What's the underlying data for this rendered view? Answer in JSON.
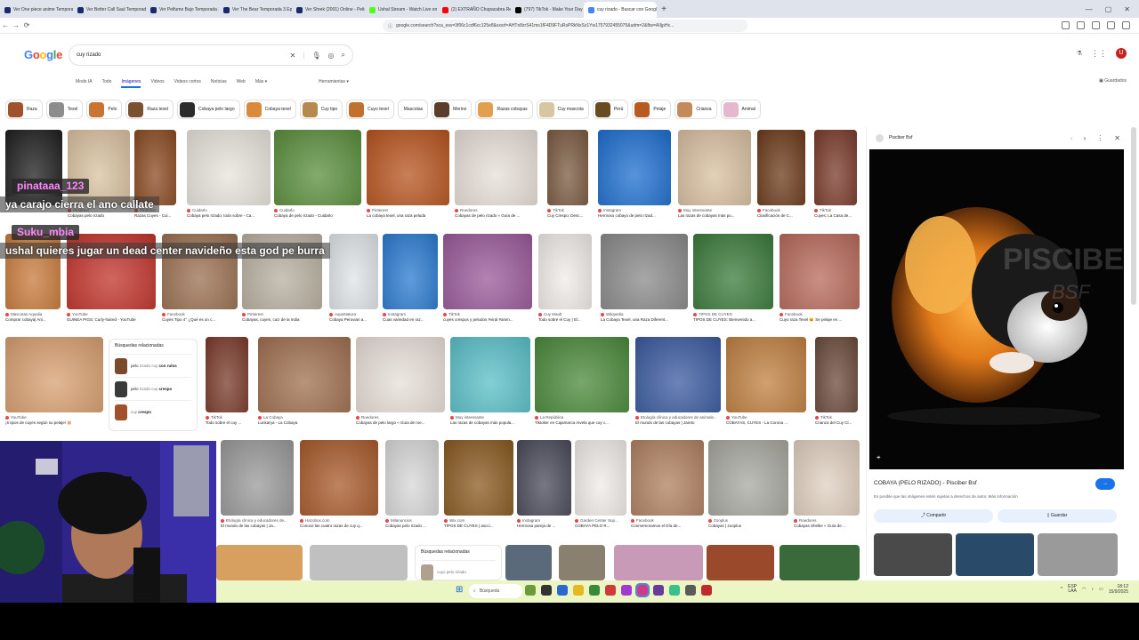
{
  "browser": {
    "tabs": [
      {
        "label": "Ver One piece anime Temporada 3 Episo",
        "color": "#1a2a6c"
      },
      {
        "label": "Ver Better Call Saul Temporada 2 Epi",
        "color": "#1a2a6c"
      },
      {
        "label": "Ver Pelfume Bajo Temporada 2 Episo",
        "color": "#1a2a6c"
      },
      {
        "label": "Ver The Bear Temporada 3 Episodio",
        "color": "#1a2a6c"
      },
      {
        "label": "Ver Shrek (2001) Online - PelisPlus",
        "color": "#1a2a6c"
      },
      {
        "label": "Ushal Stream - Watch Live on Kick",
        "color": "#53fc18"
      },
      {
        "label": "(2) EXTRAÑO Chupacabra Real En Mi C",
        "color": "#ff0000"
      },
      {
        "label": "(797) TikTok - Make Your Day",
        "color": "#000000"
      },
      {
        "label": "cuy rizado - Buscar con Google",
        "color": "#4285f4",
        "active": true
      }
    ],
    "new_tab": "+",
    "url": "google.com/search?sca_esv=3f06c1cdf6cc125e8&sxsrf=AHTn8zrS41ms1fF4D9FTuRsPRkNxSz1Yw1757932455075&udm=2&fbs=AIIjpHx...",
    "back": "←",
    "forward": "→",
    "reload": "⟳"
  },
  "google": {
    "logo": "Google",
    "query": "cuy rizado",
    "filters": [
      "Modo IA",
      "Todo",
      "Imágenes",
      "Videos",
      "Videos cortos",
      "Noticias",
      "Web",
      "Más ▾"
    ],
    "active_filter": "Imágenes",
    "tools": "Herramientas ▾",
    "saved": "Guardados",
    "avatar_letter": "U",
    "chips": [
      {
        "label": "Raza",
        "color": "#a0522d"
      },
      {
        "label": "Texel",
        "color": "#8d8d8d"
      },
      {
        "label": "Pelo",
        "color": "#c87533"
      },
      {
        "label": "Raza texel",
        "color": "#7a5230"
      },
      {
        "label": "Cobaya pelo largo",
        "color": "#2b2b2b"
      },
      {
        "label": "Cobaya texel",
        "color": "#d98a3a"
      },
      {
        "label": "Cuy tipo",
        "color": "#b58a4c"
      },
      {
        "label": "Cuyo texel",
        "color": "#c2702d"
      },
      {
        "label": "Mascotas",
        "color": "#ffffff"
      },
      {
        "label": "Merino",
        "color": "#5a3d2b"
      },
      {
        "label": "Razas cobayas",
        "color": "#e0a050"
      },
      {
        "label": "Cuy mascota",
        "color": "#d6c7a0"
      },
      {
        "label": "Perú",
        "color": "#6a4a20"
      },
      {
        "label": "Pelaje",
        "color": "#b85b20"
      },
      {
        "label": "Crianza",
        "color": "#c58a5a"
      },
      {
        "label": "Animal",
        "color": "#e6b8d0"
      }
    ]
  },
  "results": {
    "row1": [
      {
        "src": "",
        "title": "",
        "color": "#1e1e1e"
      },
      {
        "src": "Pinterest",
        "title": "Cobayas pelo rizado",
        "color": "#d9c2a0"
      },
      {
        "src": "Pinterest",
        "title": "Razas Cuyes - Cui...",
        "color": "#8a4a20"
      },
      {
        "src": "Cuidarlo",
        "title": "Cobaya pelo rizado: todo sobre - Ca...",
        "color": "#e8e4dc"
      },
      {
        "src": "Cuidarlo",
        "title": "Cobaya de pelo rizado - Cuidarlo",
        "color": "#5a8f3c"
      },
      {
        "src": "Pinterest",
        "title": "La cobaya texel, una raza peluda",
        "color": "#b8541e"
      },
      {
        "src": "Roedores",
        "title": "Cobayas de pelo rizado « Guía de ...",
        "color": "#e8e0d8"
      },
      {
        "src": "TikTok",
        "title": "Cuy Crespo: Desc...",
        "color": "#7a5a40"
      },
      {
        "src": "Instagram",
        "title": "Hermoso cobayo de pelo rizad...",
        "color": "#1e6fd0"
      },
      {
        "src": "Muy interesante",
        "title": "Las razas de cobayas más po...",
        "color": "#d8c0a0"
      },
      {
        "src": "Facebook",
        "title": "Clasificación de C...",
        "color": "#6b3a1a"
      },
      {
        "src": "TikTok",
        "title": "Cuyes: La Casa de...",
        "color": "#7a3a2a"
      }
    ],
    "row2": [
      {
        "src": "Mascotas Aqualia",
        "title": "Comprar cobaya| Ani...",
        "color": "#c87a3a"
      },
      {
        "src": "YouTube",
        "title": "GUINEA PIGS: Curly-haired - YouTube",
        "color": "#c2332a"
      },
      {
        "src": "Facebook",
        "title": "Cuyes Tipo 4° ¿Qué es un c...",
        "color": "#9a7050"
      },
      {
        "src": "Pinterest",
        "title": "Cobayas, cuyes, cuiz de la India",
        "color": "#b8b0a0"
      },
      {
        "src": "AquaNatura",
        "title": "Cobaya Peruvian a...",
        "color": "#e0e4e8"
      },
      {
        "src": "Instagram",
        "title": "Cuas variedad en raz...",
        "color": "#2a7ad0"
      },
      {
        "src": "TikTok",
        "title": "cuyes crespos y peludos #viral #anim...",
        "color": "#9a5a9a"
      },
      {
        "src": "Cuy Mault",
        "title": "Todo sobre el Cuy | El...",
        "color": "#f0ece8"
      },
      {
        "src": "Wikipedia",
        "title": "La Cobaya Texel, una Raza Diferent...",
        "color": "#8a8a8a"
      },
      {
        "src": "TIPOS DE CUYES",
        "title": "TIPOS DE CUYES: Bienvenido a...",
        "color": "#3a7a3a"
      },
      {
        "src": "Facebook",
        "title": "Cuyo raza Texel 😺 Se pelaje es ...",
        "color": "#b86a5a"
      }
    ],
    "row3": [
      {
        "src": "YouTube",
        "title": "¡6 tipos de cuyes según su pelaje! 🐹",
        "color": "#d8a070"
      },
      {
        "src": "TikTok",
        "title": "Todo sobre el cuy ...",
        "color": "#7a3a2a"
      },
      {
        "src": "La Cobaya",
        "title": "Lunkarya - La Cobaya",
        "color": "#a07050"
      },
      {
        "src": "Roedores",
        "title": "Cobayas de pelo largo « Guía de roe...",
        "color": "#e8e0d8"
      },
      {
        "src": "Muy interesante",
        "title": "Las razas de cobayas más popula...",
        "color": "#5ac0c8"
      },
      {
        "src": "La República",
        "title": "Tiktoker en Cajamarca revela que cuy c...",
        "color": "#4a8a3a"
      },
      {
        "src": "Etología clínica y educadores de animale...",
        "title": "El mundo de las cobayas | Jareto",
        "color": "#3a5aa0"
      },
      {
        "src": "YouTube",
        "title": "COBAYAS, CUYES - La Corona ...",
        "color": "#c08040"
      },
      {
        "src": "TikTok",
        "title": "Crianza del Cuy Cl...",
        "color": "#6a4a3a"
      }
    ],
    "row4": [
      {
        "src": "Etología clínica y educadores de...",
        "title": "El mundo de las cobayas | Ja...",
        "color": "#9a9a9a"
      },
      {
        "src": "Hazobox.com",
        "title": "Conoce las cuatro razas de cuy q...",
        "color": "#a85a2a"
      },
      {
        "src": "Milanuncios",
        "title": "Cobayas pelo rizado ...",
        "color": "#d8d8d8"
      },
      {
        "src": "Wix.com",
        "title": "TIPOS DE CUYES | ascci...",
        "color": "#8a5a20"
      },
      {
        "src": "Instagram",
        "title": "Hermosa pareja de ...",
        "color": "#4a4a5a"
      },
      {
        "src": "Garden Center Sup...",
        "title": "COBAYA PELO R...",
        "color": "#f0ece8"
      },
      {
        "src": "Facebook",
        "title": "Conmemoramos el Día de...",
        "color": "#b08060"
      },
      {
        "src": "Zooplus",
        "title": "Cobayas | zooplus",
        "color": "#a8a8a0"
      },
      {
        "src": "Roedores",
        "title": "Cobayas Sheltie « Guía de ...",
        "color": "#e0d0c0"
      }
    ],
    "row5_colors": [
      "#d8a060",
      "#c0c0c0",
      "#5a6a7a",
      "#8a8070",
      "#c89ab8",
      "#9a4a2a",
      "#3a6a3a"
    ]
  },
  "related1": {
    "title": "Búsquedas relacionadas",
    "items": [
      {
        "pre": "pelo",
        "mid": " rizado cuy ",
        "bold": "con rulos"
      },
      {
        "pre": "pelo",
        "mid": " rizado cuy ",
        "bold": "crespo"
      },
      {
        "pre": "",
        "mid": "cuy ",
        "bold": "crespo"
      }
    ]
  },
  "related2": {
    "title": "Búsquedas relacionadas",
    "items": [
      {
        "pre": "",
        "mid": "cuyo pelo rizado",
        "bold": ""
      }
    ]
  },
  "chat": {
    "msg1_user": "pinataaa_123",
    "msg1_text": "ya carajo cierra el ano callate",
    "msg2_user": "Suku_mbia",
    "msg2_text": "ushal quieres jugar un dead center navideño esta god pe burra"
  },
  "panel": {
    "site": "Pisciber Bsf",
    "title": "COBAYA (PELO RIZADO) - Pisciber Bsf",
    "note": "Es posible que las imágenes estén sujetas a derechos de autor. Más información",
    "watermark": "PISCIBER",
    "watermark2": "BSF",
    "visit": "→",
    "share": "Compartir",
    "save": "Guardar",
    "close": "✕",
    "more": "⋮",
    "prev": "‹",
    "next": "›"
  },
  "taskbar": {
    "search": "Búsqueda",
    "lang": "ESP",
    "lang2": "LAA",
    "time": "18:12",
    "date": "15/9/2025"
  }
}
